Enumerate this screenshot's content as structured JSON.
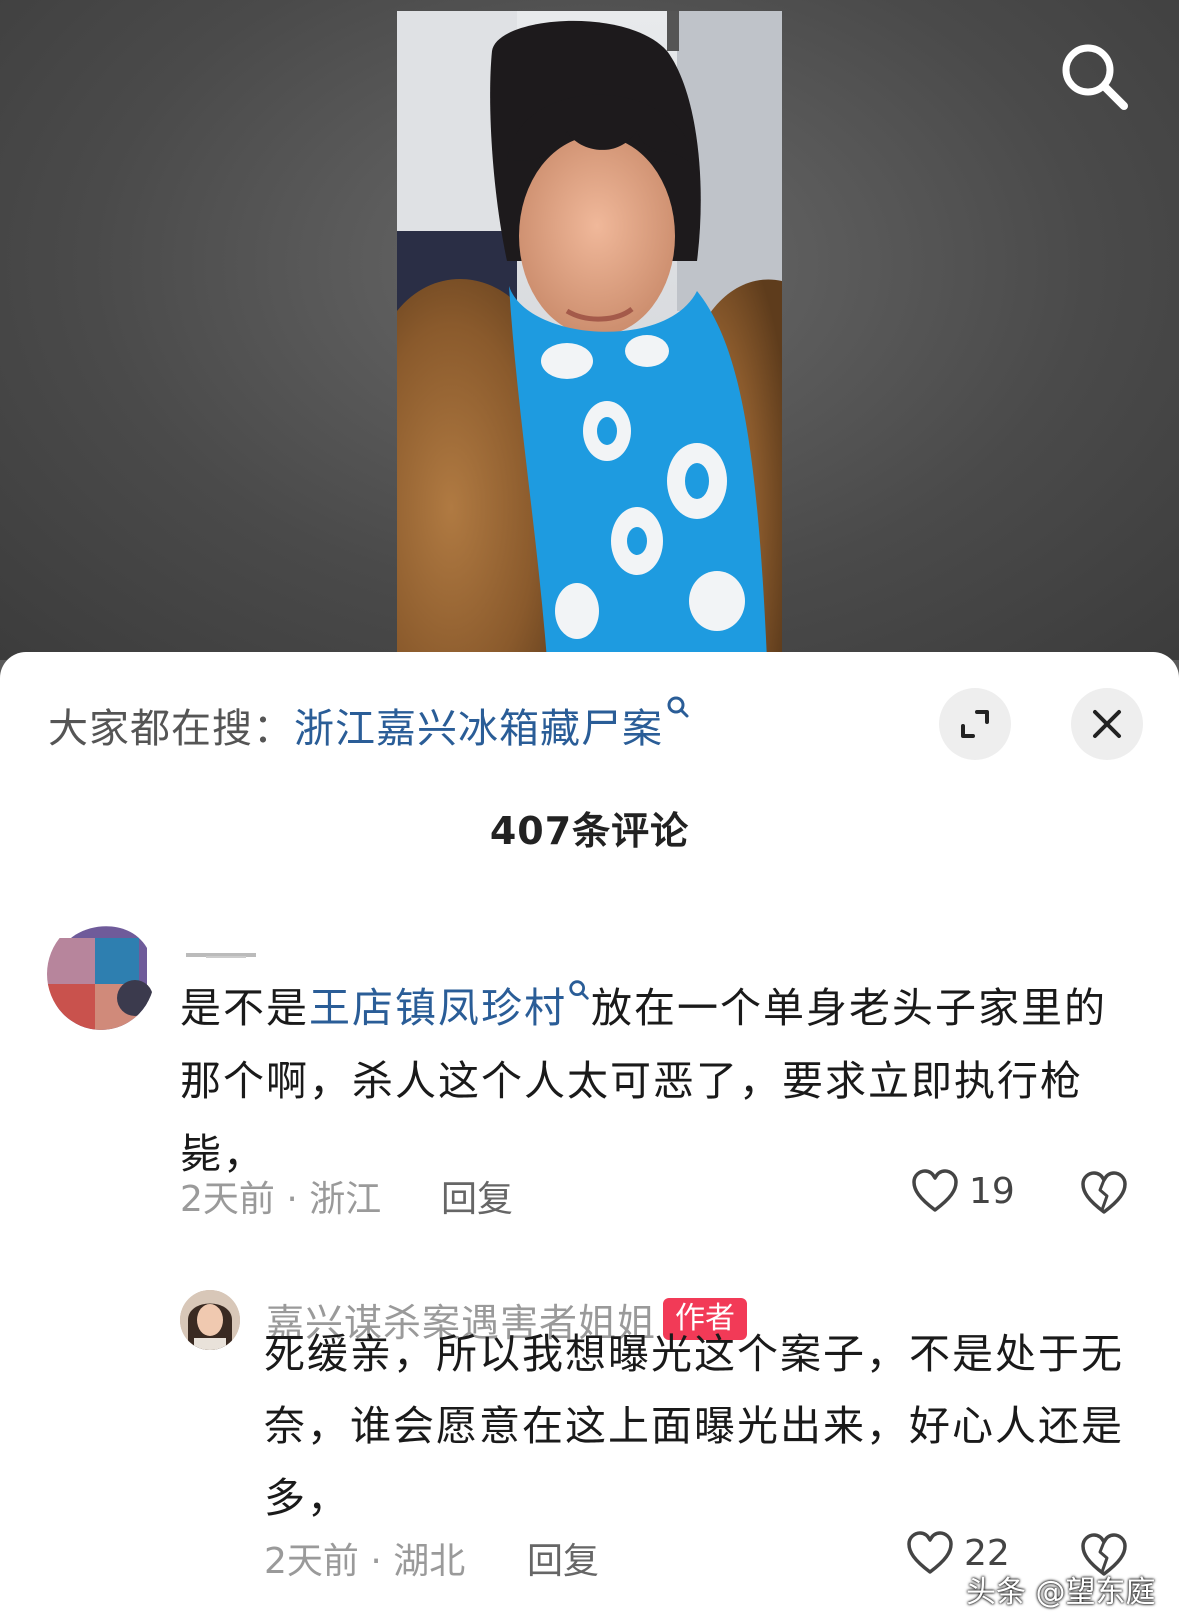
{
  "hot_search": {
    "prefix": "大家都在搜：",
    "keyword": "浙江嘉兴冰箱藏尸案"
  },
  "comments_count": "407条评论",
  "comment": {
    "text_before": "是不是",
    "keyword": "王店镇凤珍村",
    "text_after": "放在一个单身老头子家里的那个啊，杀人这个人太可恶了，要求立即执行枪毙，",
    "meta": "2天前 · 浙江",
    "reply_label": "回复",
    "likes": "19"
  },
  "reply": {
    "author": "嘉兴谋杀案遇害者姐姐",
    "badge": "作者",
    "text": "死缓亲，所以我想曝光这个案子，不是处于无奈，谁会愿意在这上面曝光出来，好心人还是多，",
    "meta": "2天前 · 湖北",
    "reply_label": "回复",
    "likes": "22"
  },
  "watermark": "头条 @望东庭",
  "icons": {
    "search": "search-icon",
    "expand": "expand-icon",
    "close": "close-icon",
    "like": "heart-icon",
    "dislike": "broken-heart-icon"
  },
  "colors": {
    "keyword": "#2a5d97",
    "author_badge": "#f23a57"
  }
}
